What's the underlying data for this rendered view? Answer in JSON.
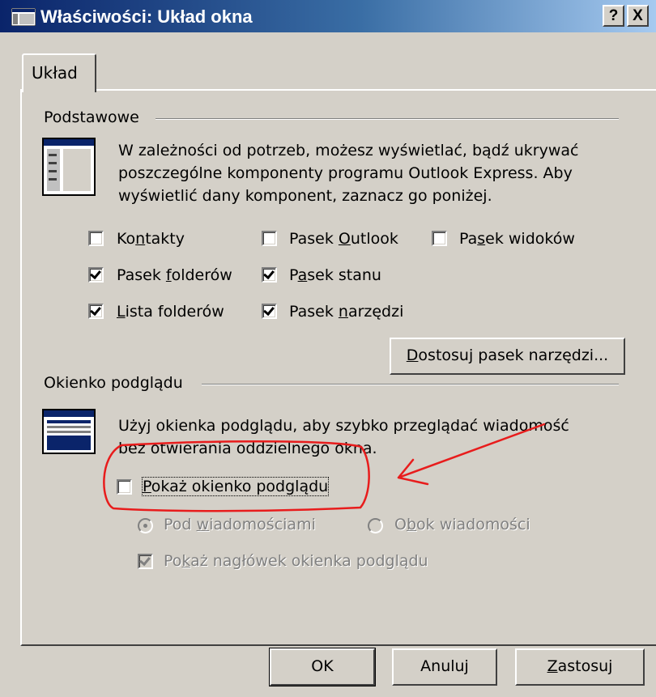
{
  "window": {
    "title": "Właściwości: Układ okna",
    "help_button": "?",
    "close_button": "X"
  },
  "tabs": [
    {
      "label": "Układ",
      "selected": true
    }
  ],
  "basic": {
    "group_title": "Podstawowe",
    "description_lines": [
      "W zależności od potrzeb, możesz wyświetlać, bądź ukrywać",
      "poszczególne komponenty programu Outlook Express. Aby",
      "wyświetlić dany komponent, zaznacz go poniżej."
    ],
    "checkboxes": {
      "contacts": {
        "pre": "Ko",
        "ul": "n",
        "post": "takty",
        "checked": false
      },
      "outlook_bar": {
        "pre": "Pasek ",
        "ul": "O",
        "post": "utlook",
        "checked": false
      },
      "views_bar": {
        "pre": "Pa",
        "ul": "s",
        "post": "ek widoków",
        "checked": false
      },
      "folder_bar": {
        "pre": "Pasek ",
        "ul": "f",
        "post": "olderów",
        "checked": true
      },
      "status_bar": {
        "pre": "P",
        "ul": "a",
        "post": "sek stanu",
        "checked": true
      },
      "folder_list": {
        "pre": "",
        "ul": "L",
        "post": "ista folderów",
        "checked": true
      },
      "toolbar": {
        "pre": "Pasek ",
        "ul": "n",
        "post": "arzędzi",
        "checked": true
      }
    },
    "customize_button": {
      "pre": "",
      "ul": "D",
      "post": "ostosuj pasek narzędzi..."
    }
  },
  "preview": {
    "group_title": "Okienko podglądu",
    "description_lines": [
      "Użyj okienka podglądu, aby szybko przeglądać wiadomość",
      "bez otwierania oddzielnego okna."
    ],
    "show_preview": {
      "pre": "",
      "ul": "P",
      "post": "okaż okienko podglądu",
      "checked": false
    },
    "below_messages": {
      "pre": "Pod ",
      "ul": "w",
      "post": "iadomościami",
      "selected": true
    },
    "beside_messages": {
      "pre": "O",
      "ul": "b",
      "post": "ok wiadomości",
      "selected": false
    },
    "show_header": {
      "pre": "Po",
      "ul": "k",
      "post": "aż nagłówek okienka podglądu",
      "checked": true
    }
  },
  "buttons": {
    "ok": {
      "label": "OK"
    },
    "cancel": {
      "label": "Anuluj"
    },
    "apply": {
      "pre": "",
      "ul": "Z",
      "post": "astosuj"
    }
  },
  "annotation": {
    "color": "#e81c1c"
  }
}
